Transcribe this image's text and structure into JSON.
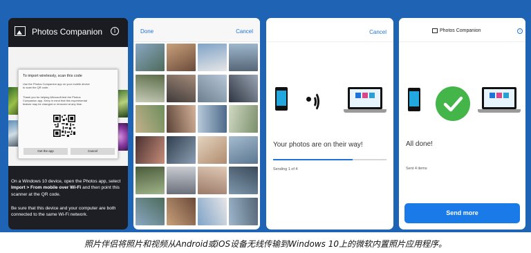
{
  "colors": {
    "background_strip": "#1f64b4",
    "accent_blue": "#1f73d8",
    "success_green": "#43b549",
    "send_button": "#1a7be8"
  },
  "screen1": {
    "app_title": "Photos Companion",
    "logo_icon": "photo-icon",
    "info_icon": "info-icon",
    "dialog": {
      "title": "To import wirelessly, scan this code",
      "body1": "Use the Photos Companion app on your mobile device to scan the QR code.",
      "body2": "Thank you for helping Microsoft test the Photos Companion app. Keep in mind that this experimental feature may be changed or removed at any time.",
      "get_app_label": "Get the app",
      "cancel_label": "Cancel"
    },
    "caption_line1_pre": "On a Windows 10 device, open the Photos app, select ",
    "caption_bold": "Import > From mobile over Wi-Fi",
    "caption_line1_post": " and then point this scanner at the QR code.",
    "caption_line2": "Be sure that this device and your computer are both connected to the same Wi-Fi network."
  },
  "screen2": {
    "done_label": "Done",
    "cancel_label": "Cancel"
  },
  "screen3": {
    "cancel_label": "Cancel",
    "message": "Your photos are on their way!",
    "progress": 0.7,
    "status": "Sending 1 of 4"
  },
  "screen4": {
    "app_title": "Photos Companion",
    "message": "All done!",
    "status": "Sent 4 items",
    "send_more_label": "Send more"
  },
  "caption": "照片伴侣将照片和视频从Android或iOS设备无线传输到Windows 10上的微软内置照片应用程序。"
}
